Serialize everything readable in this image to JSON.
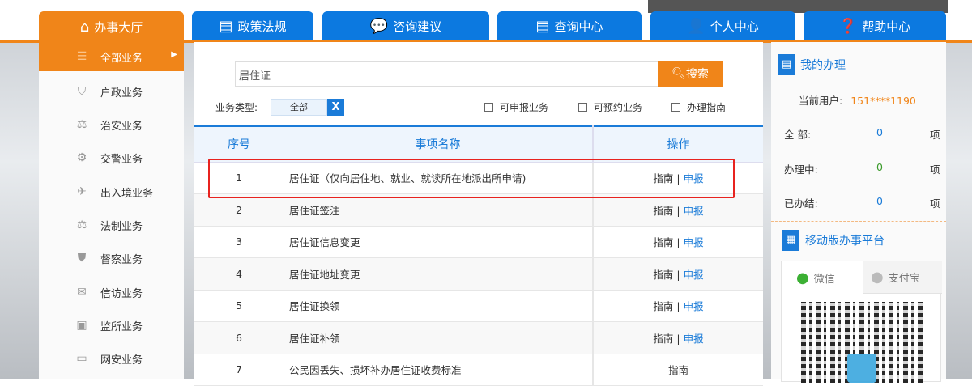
{
  "nav": [
    {
      "label": "办事大厅",
      "icon": "home-icon",
      "active": true
    },
    {
      "label": "政策法规",
      "icon": "document-icon"
    },
    {
      "label": "咨询建议",
      "icon": "chat-icon"
    },
    {
      "label": "查询中心",
      "icon": "query-icon"
    },
    {
      "label": "个人中心",
      "icon": "user-icon"
    },
    {
      "label": "帮助中心",
      "icon": "help-icon"
    }
  ],
  "sidebar": {
    "items": [
      {
        "label": "全部业务",
        "icon": "list-icon"
      },
      {
        "label": "户政业务",
        "icon": "shield-icon"
      },
      {
        "label": "治安业务",
        "icon": "scale-icon"
      },
      {
        "label": "交警业务",
        "icon": "traffic-icon"
      },
      {
        "label": "出入境业务",
        "icon": "plane-icon"
      },
      {
        "label": "法制业务",
        "icon": "scale-icon"
      },
      {
        "label": "督察业务",
        "icon": "badge-icon"
      },
      {
        "label": "信访业务",
        "icon": "mail-icon"
      },
      {
        "label": "监所业务",
        "icon": "building-icon"
      },
      {
        "label": "网安业务",
        "icon": "monitor-icon"
      }
    ]
  },
  "search": {
    "value": "居住证",
    "button": "搜索"
  },
  "filter": {
    "type_label": "业务类型:",
    "type_value": "全部",
    "clear": "X",
    "checks": [
      "可申报业务",
      "可预约业务",
      "办理指南"
    ]
  },
  "table": {
    "headers": [
      "序号",
      "事项名称",
      "操作"
    ],
    "rows": [
      {
        "no": "1",
        "name": "居住证（仅向居住地、就业、就读所在地派出所申请)",
        "guide": "指南",
        "sep": "|",
        "apply": "申报"
      },
      {
        "no": "2",
        "name": "居住证签注",
        "guide": "指南",
        "sep": "|",
        "apply": "申报"
      },
      {
        "no": "3",
        "name": "居住证信息变更",
        "guide": "指南",
        "sep": "|",
        "apply": "申报"
      },
      {
        "no": "4",
        "name": "居住证地址变更",
        "guide": "指南",
        "sep": "|",
        "apply": "申报"
      },
      {
        "no": "5",
        "name": "居住证换领",
        "guide": "指南",
        "sep": "|",
        "apply": "申报"
      },
      {
        "no": "6",
        "name": "居住证补领",
        "guide": "指南",
        "sep": "|",
        "apply": "申报"
      },
      {
        "no": "7",
        "name": "公民因丢失、损坏补办居住证收费标准",
        "guide": "指南"
      }
    ]
  },
  "right": {
    "title": "我的办理",
    "user_label": "当前用户:",
    "user_value": "151****1190",
    "stats": [
      {
        "label": "全 部:",
        "value": "0",
        "unit": "项"
      },
      {
        "label": "办理中:",
        "value": "0",
        "unit": "项"
      },
      {
        "label": "已办结:",
        "value": "0",
        "unit": "项"
      }
    ],
    "mobile_title": "移动版办事平台",
    "qr_tabs": [
      "微信",
      "支付宝"
    ]
  },
  "colors": {
    "orange": "#f08519",
    "blue": "#0c79e0",
    "highlight": "#e8231f"
  }
}
